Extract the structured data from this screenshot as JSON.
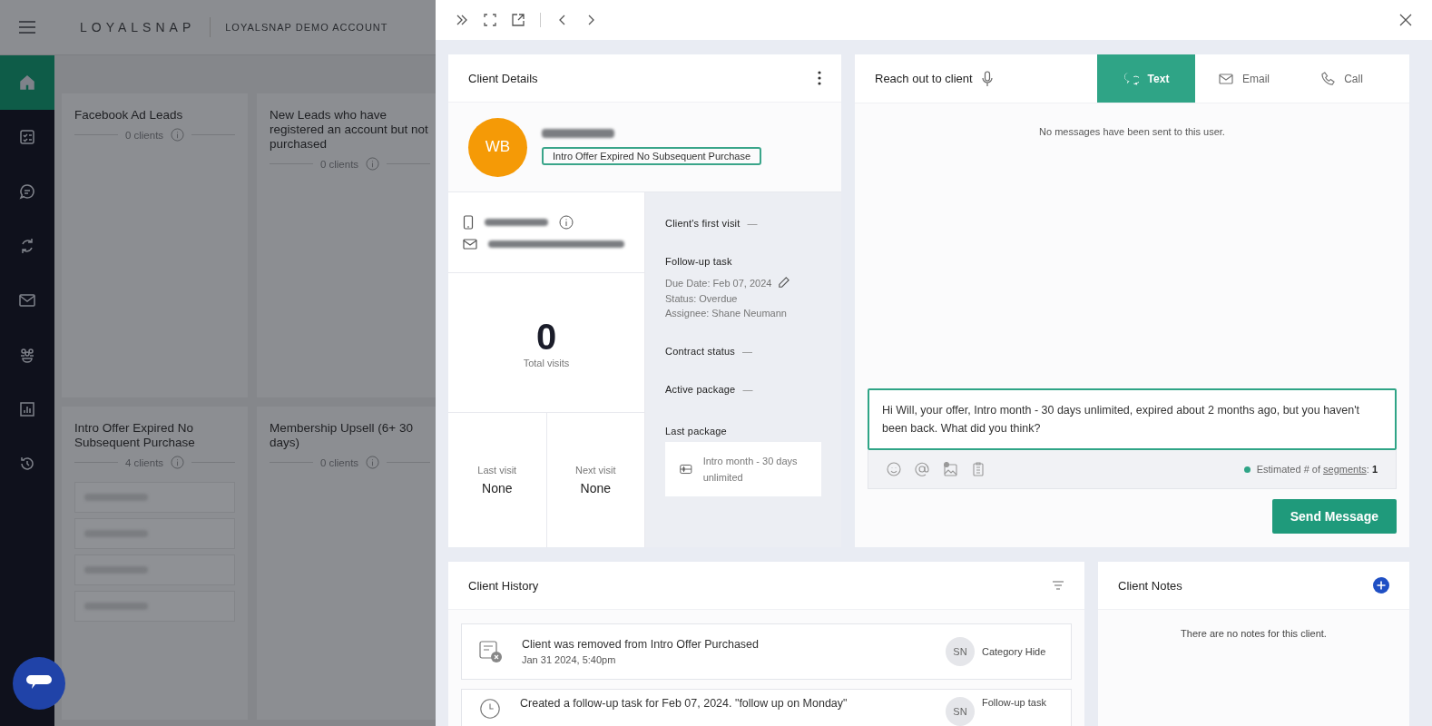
{
  "app": {
    "brand": "LOYALSNAP",
    "account": "LOYALSNAP DEMO ACCOUNT"
  },
  "nav": [
    {
      "kind": "home",
      "selected": true
    },
    {
      "kind": "tasks",
      "selected": false
    },
    {
      "kind": "chat",
      "selected": false
    },
    {
      "kind": "sync",
      "selected": false
    },
    {
      "kind": "mail",
      "selected": false
    },
    {
      "kind": "group",
      "selected": false
    },
    {
      "kind": "chart",
      "selected": false
    },
    {
      "kind": "history",
      "selected": false
    }
  ],
  "segments": [
    {
      "title": "Facebook Ad Leads",
      "count": "0 clients"
    },
    {
      "title": "New Leads who have registered an account but not purchased",
      "count": "0 clients"
    },
    {
      "title": "Intro Offer Expired No Subsequent Purchase",
      "count": "4 clients",
      "clients": [
        {
          "kind": "blurred"
        },
        {
          "kind": "blurred"
        },
        {
          "kind": "blurred"
        },
        {
          "kind": "blurred"
        }
      ]
    },
    {
      "title": "Membership Upsell (6+ 30 days)",
      "count": "0 clients"
    }
  ],
  "details": {
    "title": "Client Details",
    "initials": "WB",
    "tag": "Intro Offer Expired No Subsequent Purchase",
    "contacts": [
      {
        "kind": "phone"
      },
      {
        "kind": "email"
      }
    ],
    "total_visits": "0",
    "total_label": "Total visits",
    "last_visit_label": "Last visit",
    "last_visit": "None",
    "next_visit_label": "Next visit",
    "next_visit": "None",
    "first_visit_label": "Client's first visit",
    "first_visit": "—",
    "followup_label": "Follow-up task",
    "followup_lines": [
      "Due Date: Feb 07, 2024",
      "Status: Overdue",
      "Assignee: Shane Neumann"
    ],
    "contract_label": "Contract status",
    "contract": "—",
    "active_label": "Active package",
    "active": "—",
    "last_package_label": "Last package",
    "last_package": "Intro month - 30 days unlimited"
  },
  "reach": {
    "title": "Reach out to client",
    "tabs": [
      {
        "kind": "text",
        "label": "Text",
        "selected": true
      },
      {
        "kind": "email",
        "label": "Email",
        "selected": false
      },
      {
        "kind": "call",
        "label": "Call",
        "selected": false
      }
    ],
    "empty": "No messages have been sent to this user.",
    "message": "Hi Will, your offer, Intro month - 30 days unlimited, expired about 2 months ago, but you haven't been back. What did you think?",
    "segments_prefix": "Estimated # of",
    "segments_link": "segments",
    "segments_colon": ":",
    "segments_value": "1",
    "send": "Send Message"
  },
  "history": {
    "title": "Client History",
    "items": [
      {
        "kind": "removed",
        "text": "Client was removed from Intro Offer Purchased",
        "time": "Jan 31 2024, 5:40pm",
        "initials": "SN",
        "type": "Category Hide"
      },
      {
        "kind": "task",
        "text": "Created a follow-up task for Feb 07, 2024. \"follow up on Monday\"",
        "initials": "SN",
        "type": "Follow-up task"
      }
    ]
  },
  "notes": {
    "title": "Client Notes",
    "empty": "There are no notes for this client."
  }
}
